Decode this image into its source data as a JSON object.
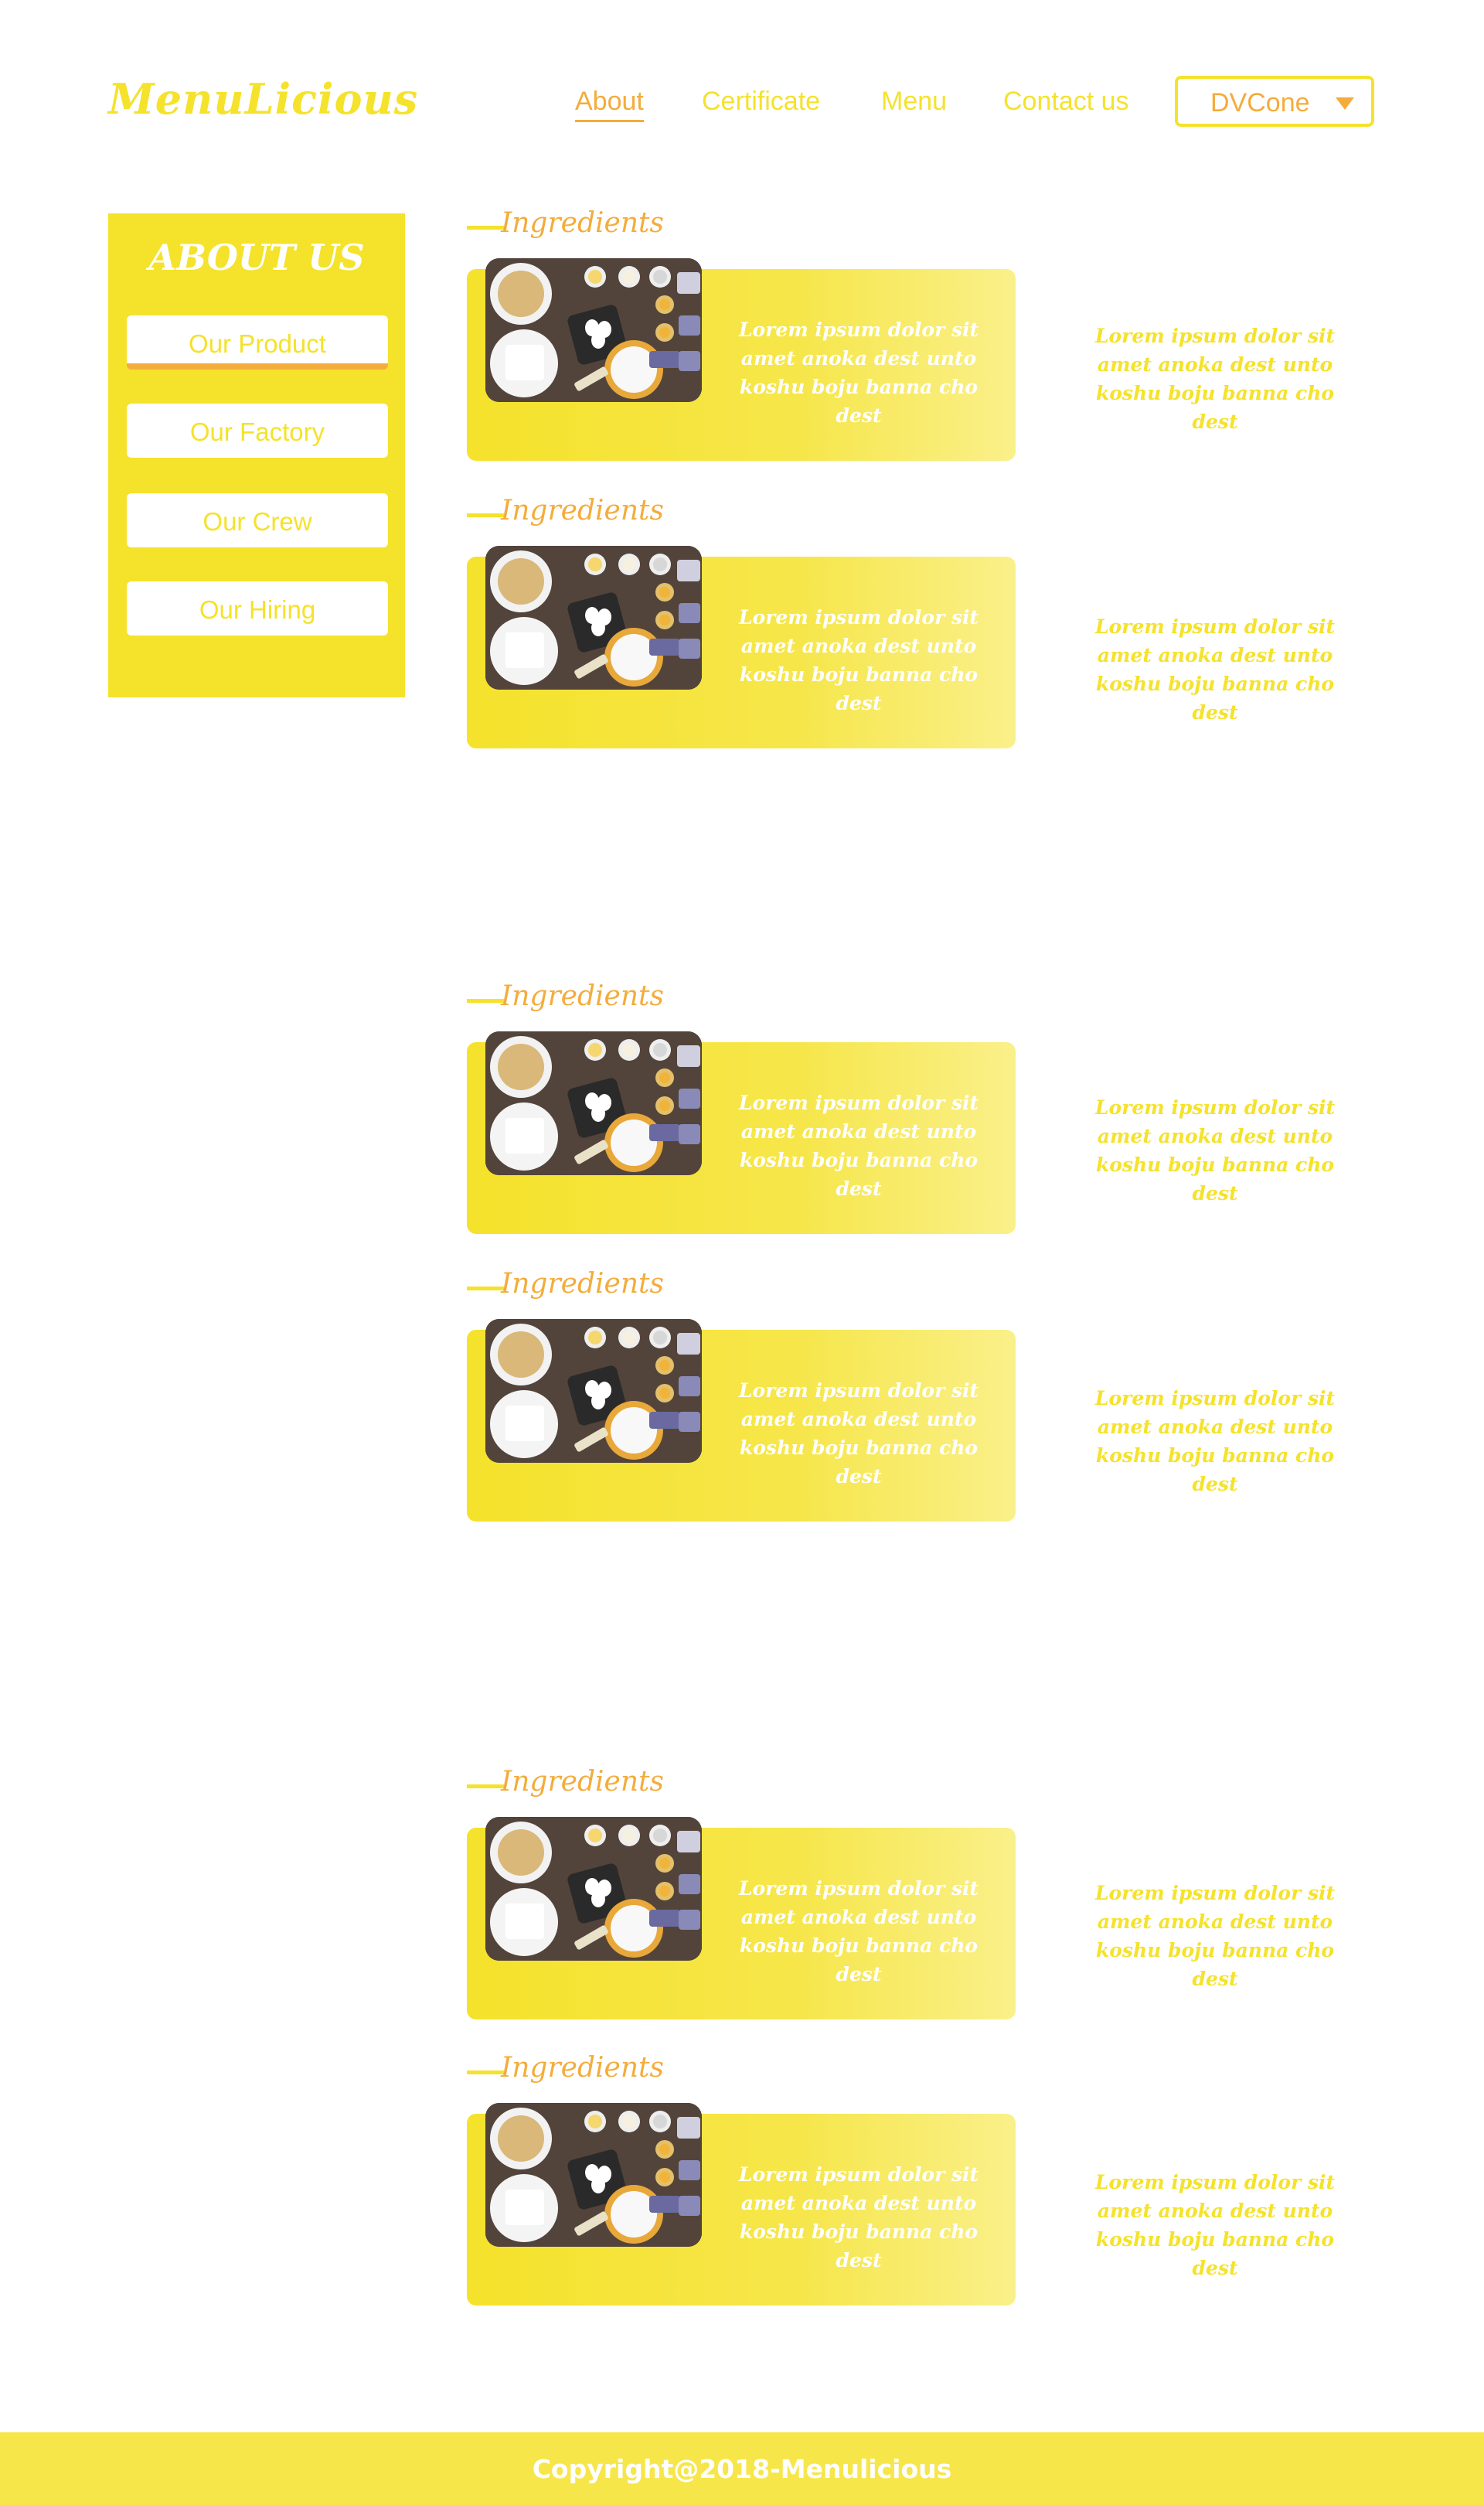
{
  "brand": {
    "logo": "MenuLicious"
  },
  "nav": {
    "items": [
      "About",
      "Certificate",
      "Menu",
      "Contact us"
    ],
    "active": "About",
    "dropdown_value": "DVCone"
  },
  "sidebar": {
    "title": "ABOUT US",
    "items": [
      "Our Product",
      "Our Factory",
      "Our Crew",
      "Our Hiring"
    ],
    "active": "Our Product"
  },
  "sections": [
    {
      "heading": "Ingredients",
      "card_text": "Lorem ipsum dolor sit amet anoka dest unto koshu boju banna cho dest",
      "side_text": "Lorem ipsum dolor sit amet anoka dest unto koshu boju banna cho dest"
    },
    {
      "heading": "Ingredients",
      "card_text": "Lorem ipsum dolor sit amet anoka dest unto koshu boju banna cho dest",
      "side_text": "Lorem ipsum dolor sit amet anoka dest unto koshu boju banna cho dest"
    },
    {
      "heading": "Ingredients",
      "card_text": "Lorem ipsum dolor sit amet anoka dest unto koshu boju banna cho dest",
      "side_text": "Lorem ipsum dolor sit amet anoka dest unto koshu boju banna cho dest"
    },
    {
      "heading": "Ingredients",
      "card_text": "Lorem ipsum dolor sit amet anoka dest unto koshu boju banna cho dest",
      "side_text": "Lorem ipsum dolor sit amet anoka dest unto koshu boju banna cho dest"
    },
    {
      "heading": "Ingredients",
      "card_text": "Lorem ipsum dolor sit amet anoka dest unto koshu boju banna cho dest",
      "side_text": "Lorem ipsum dolor sit amet anoka dest unto koshu boju banna cho dest"
    },
    {
      "heading": "Ingredients",
      "card_text": "Lorem ipsum dolor sit amet anoka dest unto koshu boju banna cho dest",
      "side_text": "Lorem ipsum dolor sit amet anoka dest unto koshu boju banna cho dest"
    }
  ],
  "footer": {
    "copyright": "Copyright@2018-Menulicious"
  },
  "colors": {
    "brand_yellow": "#f5e22b",
    "accent_orange": "#f4ac3b",
    "background": "#ffffff"
  },
  "icons": {
    "dropdown": "caret-down-icon",
    "section_image": "ingredients-photo"
  }
}
